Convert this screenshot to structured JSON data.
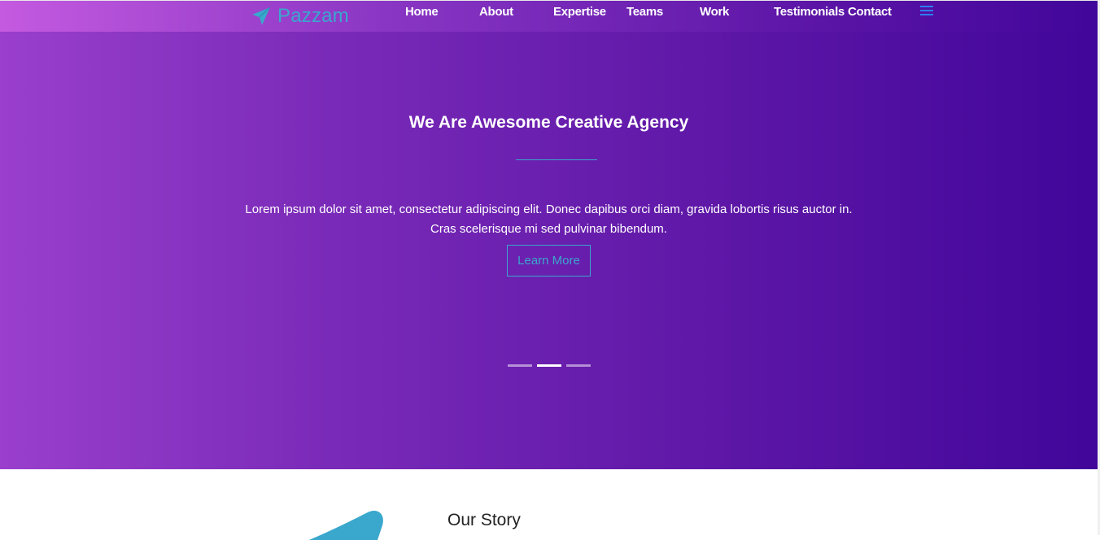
{
  "brand": {
    "name": "Pazzam",
    "icon": "paper-plane-icon",
    "color": "#3aa7cd"
  },
  "nav": {
    "items": [
      {
        "id": "home",
        "label": "Home"
      },
      {
        "id": "about",
        "label": "About"
      },
      {
        "id": "expertise",
        "label": "Expertise"
      },
      {
        "id": "teams",
        "label": "Teams"
      },
      {
        "id": "work",
        "label": "Work"
      },
      {
        "id": "testimonials",
        "label": "Testimonials"
      },
      {
        "id": "contact",
        "label": "Contact"
      }
    ],
    "menu_icon": "hamburger-menu-icon"
  },
  "hero": {
    "title": "We Are Awesome Creative Agency",
    "text_line1": "Lorem ipsum dolor sit amet, consectetur adipiscing elit. Donec dapibus orci diam, gravida lobortis risus auctor in.",
    "text_line2": "Cras scelerisque mi sed pulvinar bibendum.",
    "button_label": "Learn More",
    "slides_count": 3,
    "active_slide": 2
  },
  "story": {
    "title": "Our Story"
  },
  "colors": {
    "accent": "#3aa7cd",
    "gradient_start": "#9a3fcd",
    "gradient_end": "#41069a",
    "menu_icon": "#2f7cf0"
  }
}
